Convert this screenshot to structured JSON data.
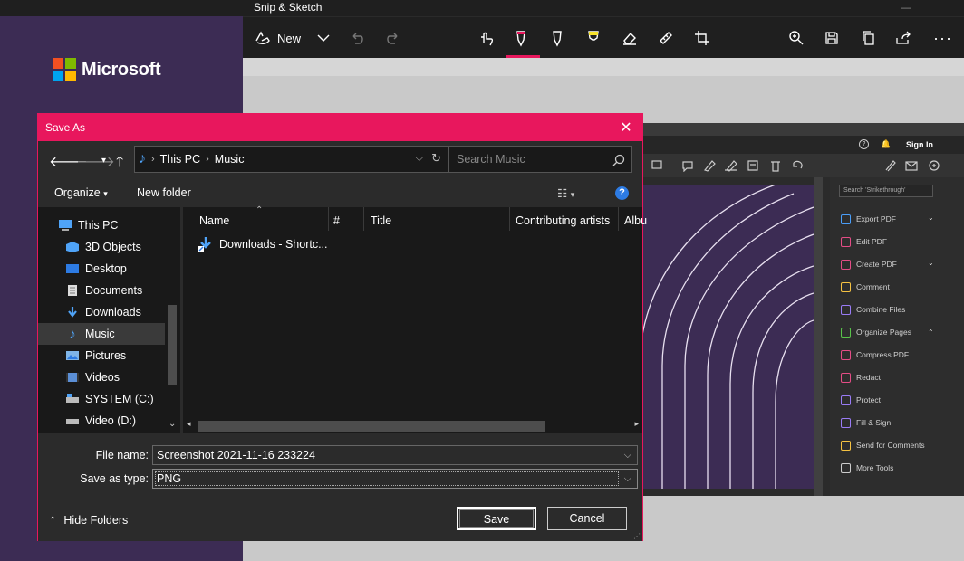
{
  "left_panel": {
    "brand": "Microsoft",
    "logo_colors": [
      "#f25022",
      "#7fba00",
      "#00a4ef",
      "#ffb900"
    ]
  },
  "snip": {
    "title": "Snip & Sketch",
    "toolbar": {
      "new_label": "New"
    },
    "accent": "#e8175d"
  },
  "acrobat": {
    "sign_in": "Sign In",
    "search_placeholder": "Search 'Strikethrough'",
    "tools": [
      {
        "label": "Export PDF",
        "color": "#4a9ef8",
        "chevron": "down"
      },
      {
        "label": "Edit PDF",
        "color": "#e44d86",
        "chevron": ""
      },
      {
        "label": "Create PDF",
        "color": "#e44d86",
        "chevron": "down"
      },
      {
        "label": "Comment",
        "color": "#f5c242",
        "chevron": ""
      },
      {
        "label": "Combine Files",
        "color": "#9a7cf5",
        "chevron": ""
      },
      {
        "label": "Organize Pages",
        "color": "#59c24a",
        "chevron": "up"
      },
      {
        "label": "Compress PDF",
        "color": "#e44d86",
        "chevron": ""
      },
      {
        "label": "Redact",
        "color": "#e44d86",
        "chevron": ""
      },
      {
        "label": "Protect",
        "color": "#9a7cf5",
        "chevron": ""
      },
      {
        "label": "Fill & Sign",
        "color": "#9a7cf5",
        "chevron": ""
      },
      {
        "label": "Send for Comments",
        "color": "#f5c242",
        "chevron": ""
      },
      {
        "label": "More Tools",
        "color": "#cccccc",
        "chevron": ""
      }
    ]
  },
  "dialog": {
    "title": "Save As",
    "address": {
      "root": "This PC",
      "folder": "Music"
    },
    "search_placeholder": "Search Music",
    "commands": {
      "organize": "Organize",
      "new_folder": "New folder"
    },
    "nav_items": [
      {
        "label": "This PC",
        "icon": "pc-icon"
      },
      {
        "label": "3D Objects",
        "icon": "3d-objects-icon"
      },
      {
        "label": "Desktop",
        "icon": "desktop-icon"
      },
      {
        "label": "Documents",
        "icon": "documents-icon"
      },
      {
        "label": "Downloads",
        "icon": "downloads-icon"
      },
      {
        "label": "Music",
        "icon": "music-icon",
        "selected": true
      },
      {
        "label": "Pictures",
        "icon": "pictures-icon"
      },
      {
        "label": "Videos",
        "icon": "videos-icon"
      },
      {
        "label": "SYSTEM (C:)",
        "icon": "drive-icon"
      },
      {
        "label": "Video (D:)",
        "icon": "drive-icon"
      }
    ],
    "columns": [
      "Name",
      "#",
      "Title",
      "Contributing artists",
      "Albu"
    ],
    "files": [
      {
        "name": "Downloads - Shortc..."
      }
    ],
    "file_name_label": "File name:",
    "file_name_value": "Screenshot 2021-11-16 233224",
    "save_type_label": "Save as type:",
    "save_type_value": "PNG",
    "save_button": "Save",
    "cancel_button": "Cancel",
    "hide_folders": "Hide Folders"
  }
}
